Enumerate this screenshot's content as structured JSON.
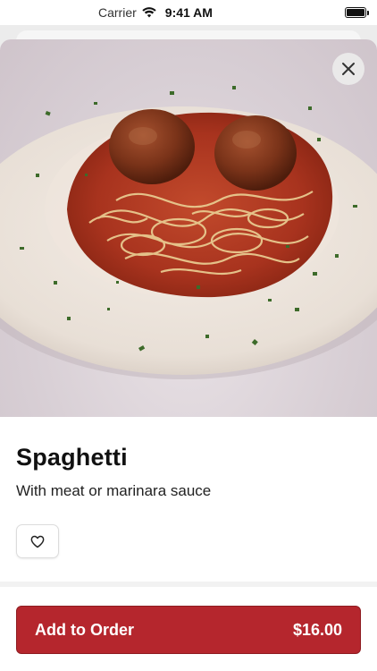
{
  "status_bar": {
    "carrier": "Carrier",
    "time": "9:41 AM",
    "wifi_icon": "wifi-icon",
    "battery_icon": "battery-icon"
  },
  "item": {
    "title": "Spaghetti",
    "description": "With meat or marinara sauce",
    "image": "spaghetti-and-meatballs-photo"
  },
  "actions": {
    "close_icon": "close-icon",
    "favorite_icon": "heart-icon",
    "add_label": "Add to Order",
    "price": "$16.00"
  },
  "colors": {
    "accent": "#b5262d",
    "accent_border": "#8e1c21"
  }
}
